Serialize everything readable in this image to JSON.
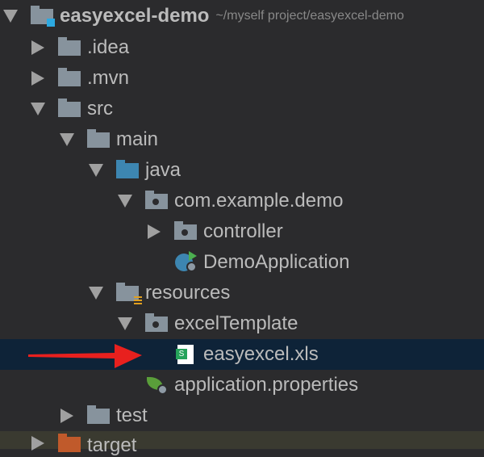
{
  "tree": {
    "root": {
      "label": "easyexcel-demo",
      "path": "~/myself project/easyexcel-demo"
    },
    "idea": ".idea",
    "mvn": ".mvn",
    "src": "src",
    "main": "main",
    "java": "java",
    "package": "com.example.demo",
    "controller": "controller",
    "app": "DemoApplication",
    "resources": "resources",
    "excelTemplate": "excelTemplate",
    "xls": "easyexcel.xls",
    "props": "application.properties",
    "test": "test",
    "target": "target"
  },
  "icons": {
    "xls_letter": "S"
  },
  "colors": {
    "selection": "#0e2338",
    "annotation_arrow": "#e8201e"
  }
}
